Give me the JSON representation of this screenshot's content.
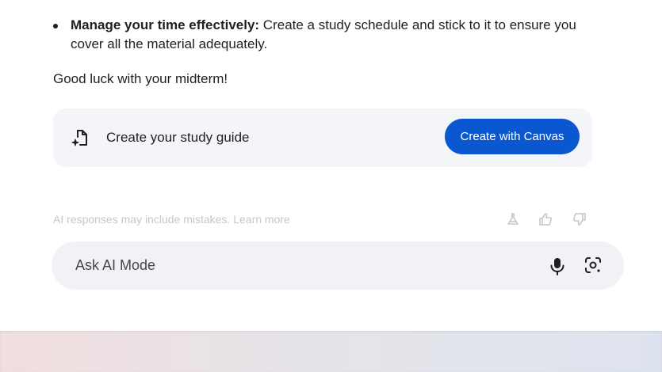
{
  "content": {
    "bullet": {
      "bold": "Manage your time effectively:",
      "text": " Create a study schedule and stick to it to ensure you cover all the material adequately."
    },
    "closing": "Good luck with your midterm!"
  },
  "canvas_card": {
    "icon": "doc-sparkle-icon",
    "label": "Create your study guide",
    "button_label": "Create with Canvas"
  },
  "disclaimer": {
    "text": "AI responses may include mistakes.",
    "link": "Learn more",
    "icons": [
      "flask-icon",
      "thumbs-up-icon",
      "thumbs-down-icon"
    ]
  },
  "ask_bar": {
    "placeholder": "Ask AI Mode",
    "value": "",
    "icons": [
      "mic-icon",
      "lens-icon"
    ]
  },
  "colors": {
    "accent": "#0b57d0",
    "text": "#1f1f1f",
    "muted": "#c4c7cc",
    "card_bg": "#f3f5f8",
    "input_bg": "#f0f2f5"
  }
}
